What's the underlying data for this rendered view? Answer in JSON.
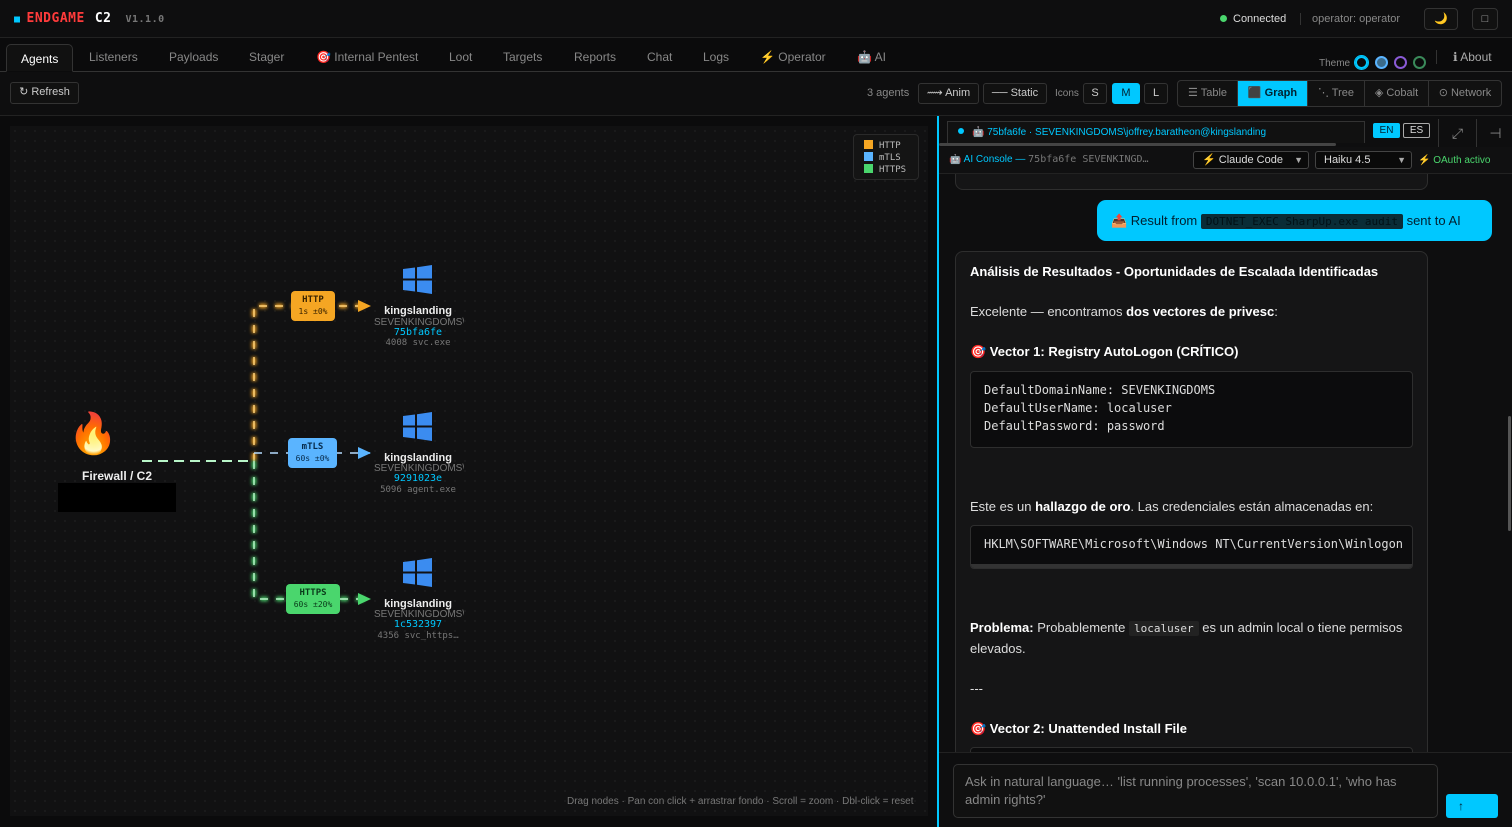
{
  "app": {
    "logo_mark": "■",
    "name": "ENDGAME",
    "suffix": "C2",
    "version": "V1.1.0",
    "status": "Connected",
    "operator": "operator: operator",
    "theme_toggle_icon": "🌙",
    "window_icon": "□"
  },
  "tabs": [
    {
      "label": "Agents"
    },
    {
      "label": "Listeners"
    },
    {
      "label": "Payloads"
    },
    {
      "label": "Stager"
    },
    {
      "label": "🎯 Internal Pentest"
    },
    {
      "label": "Loot"
    },
    {
      "label": "Targets"
    },
    {
      "label": "Reports"
    },
    {
      "label": "Chat"
    },
    {
      "label": "Logs"
    },
    {
      "label": "⚡ Operator"
    },
    {
      "label": "🤖 AI"
    }
  ],
  "theme": {
    "label": "Theme",
    "options": [
      "#00c8ff",
      "#5ab4ff",
      "#b070ff",
      "#4ad66d"
    ]
  },
  "about": "ℹ About",
  "toolbar": {
    "refresh": "↻ Refresh",
    "agent_count": "3 agents",
    "anim": "⟿ Anim",
    "static": "── Static",
    "icons_label": "Icons",
    "sizes": [
      "S",
      "M",
      "L"
    ],
    "active_size": "M",
    "views": [
      "☰ Table",
      "⬛ Graph",
      "⋱ Tree",
      "◈ Cobalt",
      "⊙ Network"
    ],
    "active_view": "⬛ Graph"
  },
  "graph": {
    "legend": [
      {
        "label": "HTTP",
        "color": "#f5a623"
      },
      {
        "label": "mTLS",
        "color": "#5ab4ff"
      },
      {
        "label": "HTTPS",
        "color": "#4ad66d"
      }
    ],
    "root": {
      "label": "Firewall / C2",
      "icon": "🔥"
    },
    "agents": [
      {
        "proto": "HTTP",
        "timing": "1s ±0%",
        "host": "kingslanding",
        "domain": "SEVENKINGDOMS\\",
        "id": "75bfa6fe",
        "proc": "4008 svc.exe",
        "color": "#f5a623"
      },
      {
        "proto": "mTLS",
        "timing": "60s ±0%",
        "host": "kingslanding",
        "domain": "SEVENKINGDOMS\\",
        "id": "9291023e",
        "proc": "5096 agent.exe",
        "color": "#5ab4ff"
      },
      {
        "proto": "HTTPS",
        "timing": "60s ±20%",
        "host": "kingslanding",
        "domain": "SEVENKINGDOMS\\",
        "id": "1c532397",
        "proc": "4356 svc_https…",
        "color": "#4ad66d"
      }
    ],
    "hint": "Drag nodes · Pan con click + arrastrar fondo · Scroll = zoom · Dbl-click = reset"
  },
  "panel": {
    "agent_tab": "🤖 75bfa6fe · SEVENKINGDOMS\\joffrey.baratheon@kingslanding",
    "langs": [
      "EN",
      "ES"
    ],
    "active_lang": "EN",
    "expand_icon": "⤢",
    "collapse_icon": "⊣",
    "ai_title": "🤖 AI Console —",
    "ai_agent": "75bfa6fe SEVENKINGD…",
    "engine": "⚡ Claude Code",
    "model": "Haiku 4.5",
    "oauth": "⚡ OAuth activo"
  },
  "chat": {
    "user_prefix": "📤 Result from",
    "user_code": "DOTNET_EXEC SharpUp.exe audit",
    "user_suffix": "sent to AI",
    "heading": "Análisis de Resultados - Oportunidades de Escalada Identificadas",
    "intro_pre": "Excelente — encontramos",
    "intro_bold": "dos vectores de privesc",
    "intro_post": ":",
    "v1": "🎯 Vector 1: Registry AutoLogon (CRÍTICO)",
    "code1": "DefaultDomainName: SEVENKINGDOMS\nDefaultUserName: localuser\nDefaultPassword: password",
    "gold_pre": "Este es un",
    "gold_bold": "hallazgo de oro",
    "gold_post": ". Las credenciales están almacenadas en:",
    "code2": "HKLM\\SOFTWARE\\Microsoft\\Windows NT\\CurrentVersion\\Winlogon",
    "prob_bold": "Problema:",
    "prob_pre": "Probablemente",
    "prob_code": "localuser",
    "prob_post": "es un admin local o tiene permisos elevados.",
    "sep": "---",
    "v2": "🎯 Vector 2: Unattended Install File"
  },
  "input": {
    "placeholder": "Ask in natural language… 'list running processes', 'scan 10.0.0.1', 'who has admin rights?'",
    "send": "↑"
  }
}
